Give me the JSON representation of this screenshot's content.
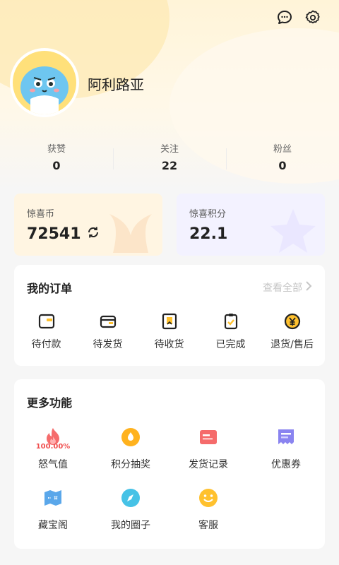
{
  "header": {
    "username": "阿利路亚"
  },
  "icons": {
    "message": "chat-bubble-icon",
    "settings": "gear-icon"
  },
  "stats": [
    {
      "label": "获赞",
      "value": "0"
    },
    {
      "label": "关注",
      "value": "22"
    },
    {
      "label": "粉丝",
      "value": "0"
    }
  ],
  "coins": {
    "label": "惊喜币",
    "value": "72541"
  },
  "points": {
    "label": "惊喜积分",
    "value": "22.1"
  },
  "orders": {
    "title": "我的订单",
    "view_all": "查看全部",
    "items": [
      {
        "label": "待付款",
        "icon": "wallet-icon"
      },
      {
        "label": "待发货",
        "icon": "card-icon"
      },
      {
        "label": "待收货",
        "icon": "package-icon"
      },
      {
        "label": "已完成",
        "icon": "clipboard-check-icon"
      },
      {
        "label": "退货/售后",
        "icon": "yen-coin-icon"
      }
    ]
  },
  "more": {
    "title": "更多功能",
    "items": [
      {
        "label": "怒气值",
        "badge": "100.00%",
        "icon": "flame-icon"
      },
      {
        "label": "积分抽奖",
        "icon": "drop-icon"
      },
      {
        "label": "发货记录",
        "icon": "record-icon"
      },
      {
        "label": "优惠券",
        "icon": "coupon-icon"
      },
      {
        "label": "藏宝阁",
        "icon": "map-icon"
      },
      {
        "label": "我的圈子",
        "icon": "compass-icon"
      },
      {
        "label": "客服",
        "icon": "smile-icon"
      }
    ]
  },
  "colors": {
    "accent_yellow": "#ffc12e",
    "accent_red": "#f05050",
    "accent_purple": "#8a84f0",
    "accent_blue": "#5aa7ea",
    "accent_cyan": "#46c2e6"
  }
}
